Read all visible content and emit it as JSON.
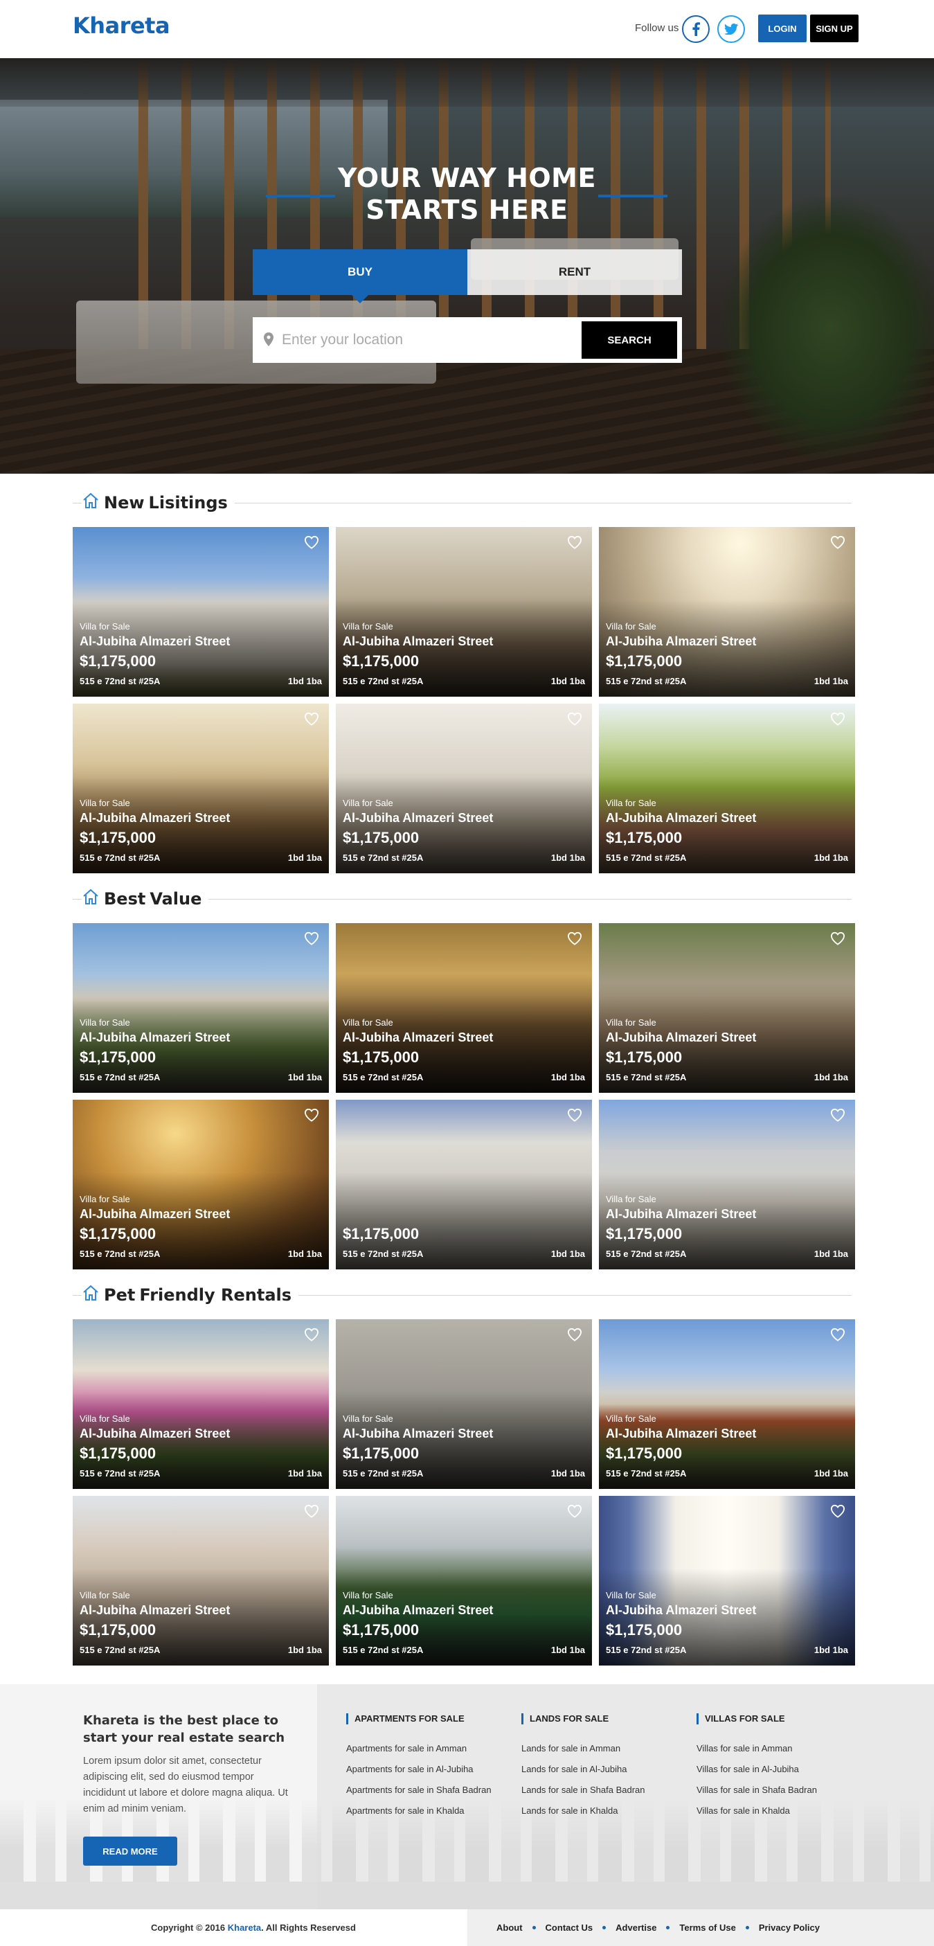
{
  "header": {
    "logo": "Khareta",
    "follow_label": "Follow us",
    "login_label": "LOGIN",
    "signup_label": "SIGN UP"
  },
  "hero": {
    "title_line1": "YOUR WAY HOME",
    "title_line2": "STARTS HERE",
    "tab_buy": "BUY",
    "tab_rent": "RENT",
    "search_placeholder": "Enter your location",
    "search_button": "SEARCH"
  },
  "sections": [
    {
      "title_light": "New",
      "title_bold": "Lisitings",
      "cards": [
        {
          "type": "Villa for Sale",
          "street": "Al-Jubiha Almazeri Street",
          "price": "$1,175,000",
          "address": "515 e 72nd st #25A",
          "beds": "1bd 1ba"
        },
        {
          "type": "Villa for Sale",
          "street": "Al-Jubiha Almazeri Street",
          "price": "$1,175,000",
          "address": "515 e 72nd st #25A",
          "beds": "1bd 1ba"
        },
        {
          "type": "Villa for Sale",
          "street": "Al-Jubiha Almazeri Street",
          "price": "$1,175,000",
          "address": "515 e 72nd st #25A",
          "beds": "1bd 1ba"
        },
        {
          "type": "Villa for Sale",
          "street": "Al-Jubiha Almazeri Street",
          "price": "$1,175,000",
          "address": "515 e 72nd st #25A",
          "beds": "1bd 1ba"
        },
        {
          "type": "Villa for Sale",
          "street": "Al-Jubiha Almazeri Street",
          "price": "$1,175,000",
          "address": "515 e 72nd st #25A",
          "beds": "1bd 1ba"
        },
        {
          "type": "Villa for Sale",
          "street": "Al-Jubiha Almazeri Street",
          "price": "$1,175,000",
          "address": "515 e 72nd st #25A",
          "beds": "1bd 1ba"
        }
      ]
    },
    {
      "title_light": "Best",
      "title_bold": "Value",
      "cards": [
        {
          "type": "Villa for Sale",
          "street": "Al-Jubiha Almazeri Street",
          "price": "$1,175,000",
          "address": "515 e 72nd st #25A",
          "beds": "1bd 1ba"
        },
        {
          "type": "Villa for Sale",
          "street": "Al-Jubiha Almazeri Street",
          "price": "$1,175,000",
          "address": "515 e 72nd st #25A",
          "beds": "1bd 1ba"
        },
        {
          "type": "Villa for Sale",
          "street": "Al-Jubiha Almazeri Street",
          "price": "$1,175,000",
          "address": "515 e 72nd st #25A",
          "beds": "1bd 1ba"
        },
        {
          "type": "Villa for Sale",
          "street": "Al-Jubiha Almazeri Street",
          "price": "$1,175,000",
          "address": "515 e 72nd st #25A",
          "beds": "1bd 1ba"
        },
        {
          "type": "",
          "street": "",
          "price": "$1,175,000",
          "address": "515 e 72nd st #25A",
          "beds": "1bd 1ba"
        },
        {
          "type": "Villa for Sale",
          "street": "Al-Jubiha Almazeri Street",
          "price": "$1,175,000",
          "address": "515 e 72nd st #25A",
          "beds": "1bd 1ba"
        }
      ]
    },
    {
      "title_light": "Pet",
      "title_bold": "Friendly Rentals",
      "cards": [
        {
          "type": "Villa for Sale",
          "street": "Al-Jubiha Almazeri Street",
          "price": "$1,175,000",
          "address": "515 e 72nd st #25A",
          "beds": "1bd 1ba"
        },
        {
          "type": "Villa for Sale",
          "street": "Al-Jubiha Almazeri Street",
          "price": "$1,175,000",
          "address": "515 e 72nd st #25A",
          "beds": "1bd 1ba"
        },
        {
          "type": "Villa for Sale",
          "street": "Al-Jubiha Almazeri Street",
          "price": "$1,175,000",
          "address": "515 e 72nd st #25A",
          "beds": "1bd 1ba"
        },
        {
          "type": "Villa for Sale",
          "street": "Al-Jubiha Almazeri Street",
          "price": "$1,175,000",
          "address": "515 e 72nd st #25A",
          "beds": "1bd 1ba"
        },
        {
          "type": "Villa for Sale",
          "street": "Al-Jubiha Almazeri Street",
          "price": "$1,175,000",
          "address": "515 e 72nd st #25A",
          "beds": "1bd 1ba"
        },
        {
          "type": "Villa for Sale",
          "street": "Al-Jubiha Almazeri Street",
          "price": "$1,175,000",
          "address": "515 e 72nd st #25A",
          "beds": "1bd 1ba"
        }
      ]
    }
  ],
  "footer": {
    "tagline": "Khareta is the best place to start your real estate search",
    "description": "Lorem ipsum dolor sit amet, consectetur adipiscing elit, sed do eiusmod tempor incididunt ut labore et dolore magna aliqua. Ut enim ad minim veniam.",
    "read_more": "READ MORE",
    "columns": [
      {
        "heading": "APARTMENTS FOR SALE",
        "links": [
          "Apartments for sale in Amman",
          "Apartments for sale in Al-Jubiha",
          "Apartments for sale in Shafa Badran",
          "Apartments for sale in Khalda"
        ]
      },
      {
        "heading": "LANDS FOR SALE",
        "links": [
          "Lands for sale in Amman",
          "Lands for sale in Al-Jubiha",
          "Lands for sale in Shafa Badran",
          "Lands for sale in Khalda"
        ]
      },
      {
        "heading": "VILLAS FOR SALE",
        "links": [
          "Villas for sale in Amman",
          "Villas for sale in Al-Jubiha",
          "Villas for sale in Shafa Badran",
          "Villas for sale in Khalda"
        ]
      }
    ]
  },
  "bottom_bar": {
    "copyright_prefix": "Copyright © 2016",
    "copyright_brand": "Khareta",
    "copyright_suffix": ". All Rights Reservesd",
    "nav": [
      "About",
      "Contact Us",
      "Advertise",
      "Terms of Use",
      "Privacy Policy"
    ]
  },
  "colors": {
    "brand_blue": "#1565b4",
    "black": "#000000",
    "footer_bg": "#e9e9e9"
  }
}
